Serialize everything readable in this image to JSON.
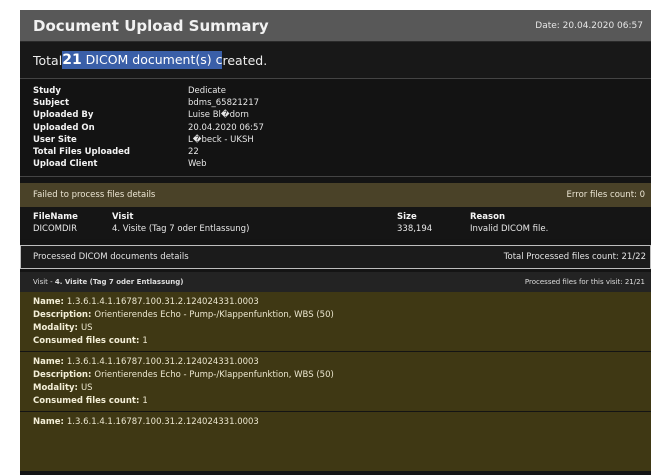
{
  "header": {
    "title": "Document Upload Summary",
    "date": "Date: 20.04.2020 06:57"
  },
  "summary": {
    "prefix": "Total ",
    "count": "21",
    "highlighted": " DICOM document(s) c",
    "suffix": "reated."
  },
  "info": [
    {
      "label": "Study",
      "value": "Dedicate"
    },
    {
      "label": "Subject",
      "value": "bdms_65821217"
    },
    {
      "label": "Uploaded By",
      "value": "Luise Bl�dorn"
    },
    {
      "label": "Uploaded On",
      "value": "20.04.2020 06:57"
    },
    {
      "label": "User Site",
      "value": "L�beck - UKSH"
    },
    {
      "label": "Total Files Uploaded",
      "value": "22"
    },
    {
      "label": "Upload Client",
      "value": "Web"
    }
  ],
  "failed": {
    "title": "Failed to process files details",
    "count": "Error files count: 0",
    "columns": [
      "FileName",
      "Visit",
      "Size",
      "Reason"
    ],
    "rows": [
      [
        "DICOMDIR",
        "4. Visite (Tag 7 oder Entlassung)",
        "338,194",
        "Invalid DICOM file."
      ]
    ]
  },
  "processed": {
    "title": "Processed DICOM documents details",
    "count": "Total Processed files count: 21/22",
    "visit_prefix": "Visit - ",
    "visit_name": "4. Visite (Tag 7 oder Entlassung)",
    "visit_count": "Processed files for this visit: 21/21",
    "documents": [
      {
        "name": "1.3.6.1.4.1.16787.100.31.2.124024331.0003",
        "description": "Orientierendes Echo - Pump-/Klappenfunktion, WBS (50)",
        "modality": "US",
        "consumed": "1"
      },
      {
        "name": "1.3.6.1.4.1.16787.100.31.2.124024331.0003",
        "description": "Orientierendes Echo - Pump-/Klappenfunktion, WBS (50)",
        "modality": "US",
        "consumed": "1"
      },
      {
        "name": "1.3.6.1.4.1.16787.100.31.2.124024331.0003",
        "description": "",
        "modality": "",
        "consumed": ""
      }
    ]
  },
  "labels": {
    "name": "Name:",
    "description": "Description:",
    "modality": "Modality:",
    "consumed": "Consumed files count:"
  }
}
